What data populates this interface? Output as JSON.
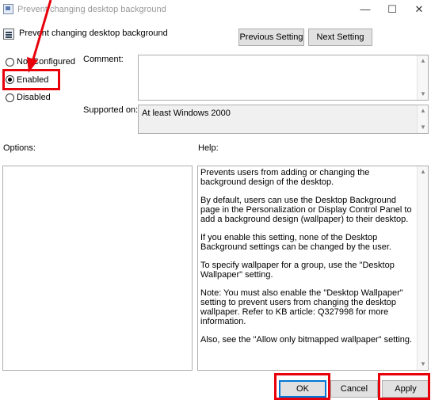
{
  "window": {
    "title": "Prevent changing desktop background",
    "minimize_glyph": "—",
    "maximize_glyph": "☐",
    "close_glyph": "✕"
  },
  "header": {
    "policy_title": "Prevent changing desktop background",
    "previous_button": "Previous Setting",
    "next_button": "Next Setting"
  },
  "state": {
    "options": [
      {
        "label": "Not Configured",
        "selected": false
      },
      {
        "label": "Enabled",
        "selected": true
      },
      {
        "label": "Disabled",
        "selected": false
      }
    ]
  },
  "fields": {
    "comment_label": "Comment:",
    "comment_value": "",
    "supported_label": "Supported on:",
    "supported_value": "At least Windows 2000"
  },
  "panels": {
    "options_label": "Options:",
    "help_label": "Help:",
    "help_paragraphs": [
      "Prevents users from adding or changing the background design of the desktop.",
      "By default, users can use the Desktop Background page in the Personalization or Display Control Panel to add a background design (wallpaper) to their desktop.",
      "If you enable this setting, none of the Desktop Background settings can be changed by the user.",
      "To specify wallpaper for a group, use the \"Desktop Wallpaper\" setting.",
      "Note: You must also enable the \"Desktop Wallpaper\" setting to prevent users from changing the desktop wallpaper. Refer to KB article: Q327998 for more information.",
      "Also, see the \"Allow only bitmapped wallpaper\" setting."
    ]
  },
  "footer": {
    "ok": "OK",
    "cancel": "Cancel",
    "apply": "Apply"
  },
  "annotations": {
    "highlight_color": "#e8000b"
  }
}
